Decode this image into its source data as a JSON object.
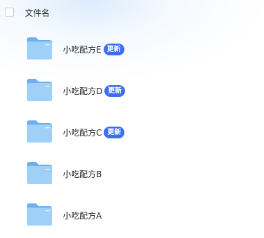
{
  "header": {
    "column_label": "文件名"
  },
  "files": [
    {
      "name": "小吃配方E",
      "badge": "更新"
    },
    {
      "name": "小吃配方D",
      "badge": "更新"
    },
    {
      "name": "小吃配方C",
      "badge": "更新"
    },
    {
      "name": "小吃配方B"
    },
    {
      "name": "小吃配方A"
    }
  ],
  "colors": {
    "badge_bg": "#3d6ef0",
    "folder_light": "#9fd0f7",
    "folder_dark": "#6cb0ee",
    "text": "#1f2329"
  },
  "icons": {
    "folder": "folder-icon",
    "checkbox": "checkbox-icon"
  }
}
